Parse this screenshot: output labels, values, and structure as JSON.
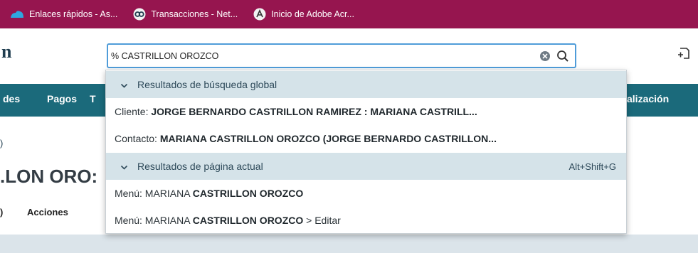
{
  "bookmarks": [
    {
      "label": "Enlaces rápidos - As...",
      "icon": "cloud-icon"
    },
    {
      "label": "Transacciones - Net...",
      "icon": "netsuite-logo-icon"
    },
    {
      "label": "Inicio de Adobe Acr...",
      "icon": "adobe-acrobat-icon"
    }
  ],
  "header": {
    "logo_fragment": "n",
    "search": {
      "value": "% CASTRILLON OROZCO",
      "placeholder": ""
    }
  },
  "nav": {
    "items": [
      "des",
      "Pagos",
      "T",
      "alización"
    ]
  },
  "page": {
    "breadcrumb_fragment": ")",
    "title_fragment": ".LON ORO:",
    "tab_fragment": ")",
    "actions_label": "Acciones"
  },
  "dropdown": {
    "global": {
      "header": "Resultados de búsqueda global",
      "results": [
        {
          "prefix": "Cliente: ",
          "bold": "JORGE BERNARDO CASTRILLON RAMIREZ : MARIANA CASTRILL...",
          "suffix": ""
        },
        {
          "prefix": "Contacto: ",
          "bold": "MARIANA CASTRILLON OROZCO (JORGE BERNARDO CASTRILLON...",
          "suffix": ""
        }
      ]
    },
    "page": {
      "header": "Resultados de página actual",
      "shortcut": "Alt+Shift+G",
      "results": [
        {
          "prefix": "Menú:  MARIANA ",
          "bold": "CASTRILLON OROZCO",
          "suffix": ""
        },
        {
          "prefix": "Menú:  MARIANA ",
          "bold": "CASTRILLON OROZCO",
          "suffix": " > Editar"
        }
      ]
    }
  },
  "colors": {
    "bookmark_bar": "#96154f",
    "nav_bar": "#1b6a7b",
    "section_header": "#d5e3e9",
    "search_border": "#4f9cd9"
  }
}
